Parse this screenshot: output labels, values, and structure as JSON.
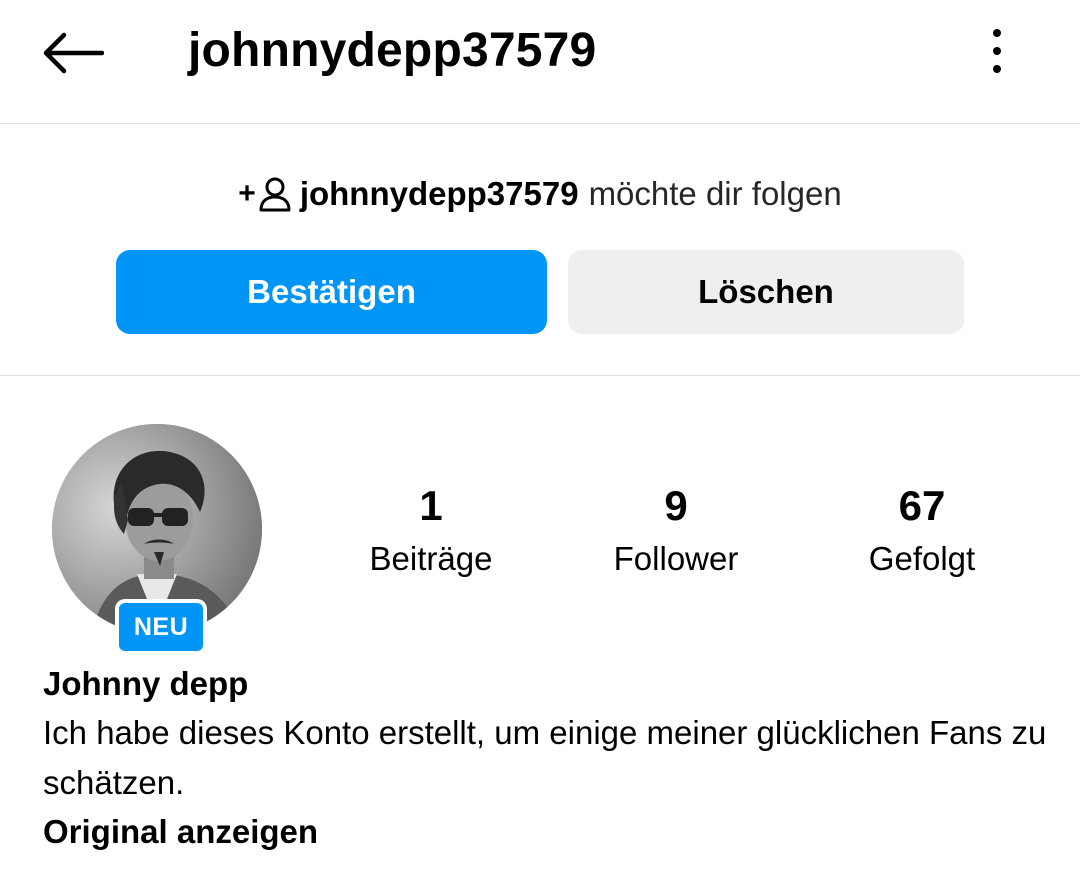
{
  "header": {
    "username": "johnnydepp37579",
    "back_icon": "arrow-left-icon",
    "more_icon": "more-vertical-icon"
  },
  "follow_request": {
    "icon": "person-add-icon",
    "plus_sign": "+",
    "username": "johnnydepp37579",
    "text": "möchte dir folgen",
    "confirm_label": "Bestätigen",
    "delete_label": "Löschen"
  },
  "profile": {
    "badge": "NEU",
    "stats": {
      "posts_count": "1",
      "posts_label": "Beiträge",
      "followers_count": "9",
      "followers_label": "Follower",
      "following_count": "67",
      "following_label": "Gefolgt"
    },
    "display_name": "Johnny depp",
    "bio": "Ich habe dieses Konto erstellt, um einige meiner glücklichen Fans zu schätzen.",
    "translate_label": "Original anzeigen"
  },
  "colors": {
    "accent": "#0095f6",
    "secondary_button": "#efefef",
    "divider": "#e0e0e0"
  }
}
